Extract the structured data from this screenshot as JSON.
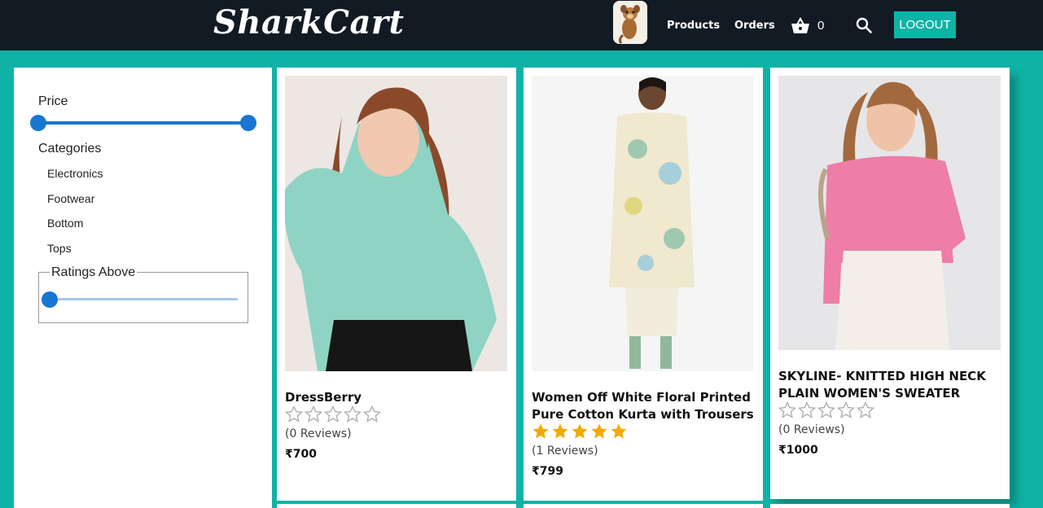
{
  "header": {
    "logo": "SharkCart",
    "nav": {
      "products": "Products",
      "orders": "Orders"
    },
    "cart_count": "0",
    "logout_label": "LOGOUT",
    "icons": {
      "cart": "basket-icon",
      "search": "search-icon",
      "avatar": "user-avatar"
    }
  },
  "filters": {
    "price_label": "Price",
    "categories_label": "Categories",
    "categories": [
      "Electronics",
      "Footwear",
      "Bottom",
      "Tops"
    ],
    "ratings_label": "Ratings Above"
  },
  "products": [
    {
      "name": "DressBerry",
      "rating": 0,
      "reviews": "(0 Reviews)",
      "price": "₹700"
    },
    {
      "name": "Women Off White Floral Printed Pure Cotton Kurta with Trousers",
      "rating": 5,
      "reviews": "(1 Reviews)",
      "price": "₹799"
    },
    {
      "name": "SKYLINE- KNITTED HIGH NECK PLAIN WOMEN'S SWEATER",
      "rating": 0,
      "reviews": "(0 Reviews)",
      "price": "₹1000"
    }
  ],
  "colors": {
    "header_bg": "#121a24",
    "accent_teal": "#0fb3a6",
    "slider_blue": "#1976d2",
    "star_filled": "#f5a900",
    "star_empty": "#b0b0b0"
  }
}
